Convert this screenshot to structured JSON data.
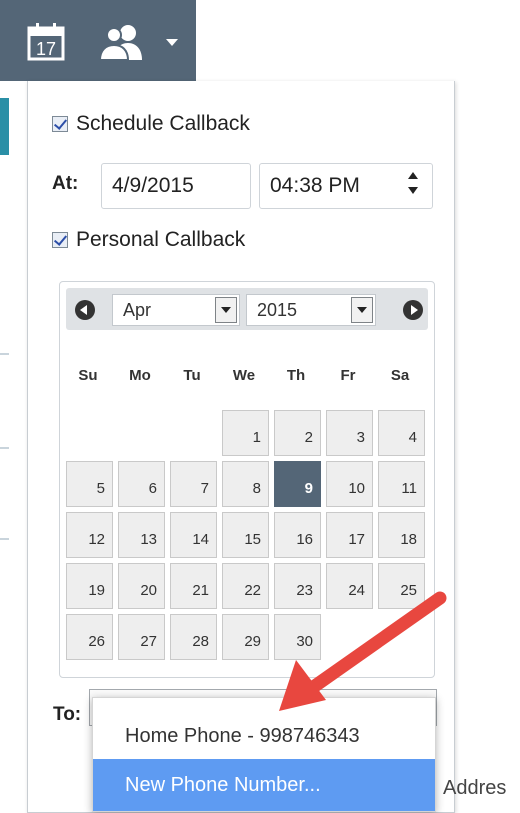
{
  "toolbar": {
    "calendar_icon": "calendar-icon",
    "calendar_day": "17",
    "contacts_icon": "contacts-icon",
    "caret_icon": "chevron-down-icon",
    "background": "#546677"
  },
  "schedule": {
    "schedule_callback_label": "Schedule Callback",
    "schedule_callback_checked": true,
    "at_label": "At:",
    "date_value": "4/9/2015",
    "time_value": "04:38 PM",
    "personal_callback_label": "Personal Callback",
    "personal_callback_checked": true
  },
  "calendar": {
    "month": "Apr",
    "year": "2015",
    "weekdays": [
      "Su",
      "Mo",
      "Tu",
      "We",
      "Th",
      "Fr",
      "Sa"
    ],
    "days": [
      "1",
      "2",
      "3",
      "4",
      "5",
      "6",
      "7",
      "8",
      "9",
      "10",
      "11",
      "12",
      "13",
      "14",
      "15",
      "16",
      "17",
      "18",
      "19",
      "20",
      "21",
      "22",
      "23",
      "24",
      "25",
      "26",
      "27",
      "28",
      "29",
      "30"
    ],
    "first_weekday_index": 3,
    "selected_day": "9",
    "selected_color": "#546677"
  },
  "to": {
    "label": "To:",
    "options": [
      "Home Phone - 998746343",
      "New Phone Number..."
    ],
    "highlighted_option_index": 1,
    "highlight_color": "#5e9bf2"
  },
  "background": {
    "address_fragment": "Addres"
  },
  "annotation": {
    "arrow_color": "#e8473f"
  }
}
